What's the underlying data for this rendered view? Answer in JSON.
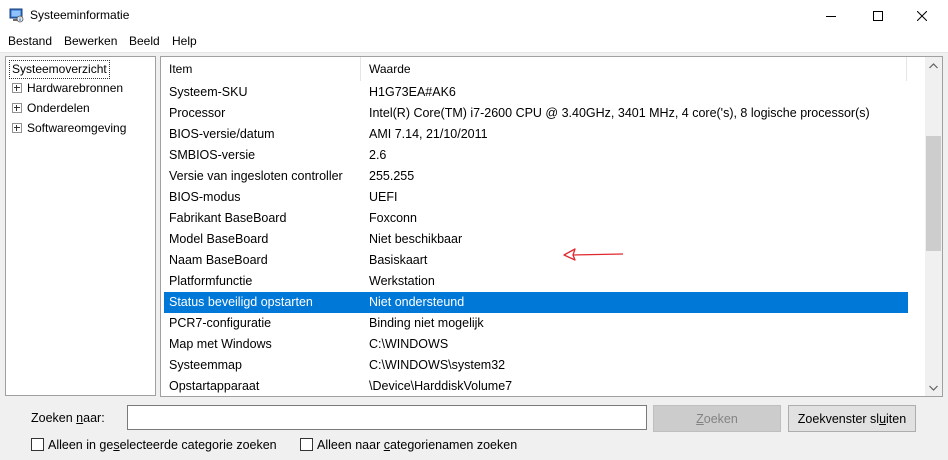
{
  "window": {
    "title": "Systeeminformatie",
    "controls": [
      "minimize-icon",
      "maximize-icon",
      "close-icon"
    ]
  },
  "menu": {
    "items": [
      {
        "label": "Bestand"
      },
      {
        "label": "Bewerken"
      },
      {
        "label": "Beeld"
      },
      {
        "label": "Help"
      }
    ]
  },
  "tree": {
    "root": "Systeemoverzicht",
    "children": [
      {
        "label": "Hardwarebronnen"
      },
      {
        "label": "Onderdelen"
      },
      {
        "label": "Softwareomgeving"
      }
    ]
  },
  "list": {
    "columns": [
      "Item",
      "Waarde"
    ],
    "rows": [
      {
        "item": "Systeem-SKU",
        "value": "H1G73EA#AK6"
      },
      {
        "item": "Processor",
        "value": "Intel(R) Core(TM) i7-2600 CPU @ 3.40GHz, 3401 MHz, 4 core('s), 8 logische processor(s)"
      },
      {
        "item": "BIOS-versie/datum",
        "value": "AMI 7.14, 21/10/2011"
      },
      {
        "item": "SMBIOS-versie",
        "value": "2.6"
      },
      {
        "item": "Versie van ingesloten controller",
        "value": "255.255"
      },
      {
        "item": "BIOS-modus",
        "value": "UEFI"
      },
      {
        "item": "Fabrikant BaseBoard",
        "value": "Foxconn"
      },
      {
        "item": "Model BaseBoard",
        "value": "Niet beschikbaar"
      },
      {
        "item": "Naam BaseBoard",
        "value": "Basiskaart"
      },
      {
        "item": "Platformfunctie",
        "value": "Werkstation"
      },
      {
        "item": "Status beveiligd opstarten",
        "value": "Niet ondersteund"
      },
      {
        "item": "PCR7-configuratie",
        "value": "Binding niet mogelijk"
      },
      {
        "item": "Map met Windows",
        "value": "C:\\WINDOWS"
      },
      {
        "item": "Systeemmap",
        "value": "C:\\WINDOWS\\system32"
      },
      {
        "item": "Opstartapparaat",
        "value": "\\Device\\HarddiskVolume7"
      }
    ],
    "selected_item": "Status beveiligd opstarten"
  },
  "annotation": {
    "icon": "red-arrow-icon",
    "color": "#e0282e",
    "target_item": "BIOS-modus"
  },
  "search": {
    "label_prefix": "Zoeken ",
    "label_mnemonic": "n",
    "label_suffix": "aar:",
    "value": "",
    "find_prefix": "",
    "find_mnemonic": "Z",
    "find_suffix": "oeken",
    "close_prefix": "Zoekvenster sl",
    "close_mnemonic": "u",
    "close_suffix": "iten",
    "checkbox1_prefix": "Alleen in ge",
    "checkbox1_mnemonic": "s",
    "checkbox1_suffix": "electeerde categorie zoeken",
    "checkbox1_checked": false,
    "checkbox2_prefix": "Alleen naar ",
    "checkbox2_mnemonic": "c",
    "checkbox2_suffix": "ategorienamen zoeken",
    "checkbox2_checked": false
  },
  "colors": {
    "selection": "#0078d7",
    "accent_arrow": "#e0282e"
  }
}
